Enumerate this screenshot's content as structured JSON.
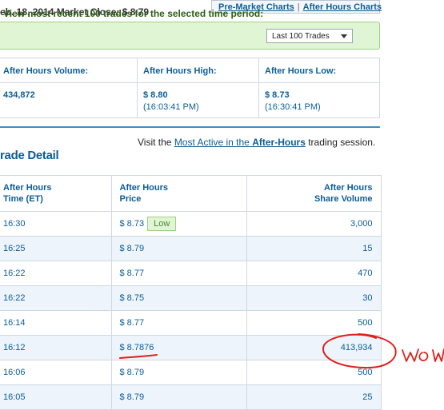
{
  "header": {
    "market_close_text": "eb. 18, 2014 Market Close: $ 8.79",
    "premarket_link": "Pre-Market Charts",
    "separator": "|",
    "afterhours_link": "After Hours Charts"
  },
  "filter": {
    "label": "View most recent 100 trades for the selected time period:",
    "selected": "Last 100 Trades"
  },
  "stats": {
    "volume_label": "After Hours Volume:",
    "volume_value": "434,872",
    "high_label": "After Hours High:",
    "high_value": "$ 8.80",
    "high_time": "(16:03:41 PM)",
    "low_label": "After Hours Low:",
    "low_value": "$ 8.73",
    "low_time": "(16:30:41 PM)"
  },
  "visit": {
    "prefix": "Visit the",
    "link_a": "Most Active in the",
    "link_b": "After-Hours",
    "suffix": "trading session."
  },
  "trade_detail": {
    "title": "rade Detail",
    "col_time_1": "After Hours",
    "col_time_2": "Time (ET)",
    "col_price_1": "After Hours",
    "col_price_2": "Price",
    "col_vol_1": "After Hours",
    "col_vol_2": "Share Volume",
    "low_badge": "Low",
    "rows": [
      {
        "time": "16:30",
        "price": "$ 8.73",
        "volume": "3,000"
      },
      {
        "time": "16:25",
        "price": "$ 8.79",
        "volume": "15"
      },
      {
        "time": "16:22",
        "price": "$ 8.77",
        "volume": "470"
      },
      {
        "time": "16:22",
        "price": "$ 8.75",
        "volume": "30"
      },
      {
        "time": "16:14",
        "price": "$ 8.77",
        "volume": "500"
      },
      {
        "time": "16:12",
        "price": "$ 8.7876",
        "volume": "413,934"
      },
      {
        "time": "16:06",
        "price": "$ 8.79",
        "volume": "500"
      },
      {
        "time": "16:05",
        "price": "$ 8.79",
        "volume": "25"
      }
    ]
  },
  "annotation": {
    "handwritten_note": "WoW",
    "ink_color": "#e0201c"
  }
}
